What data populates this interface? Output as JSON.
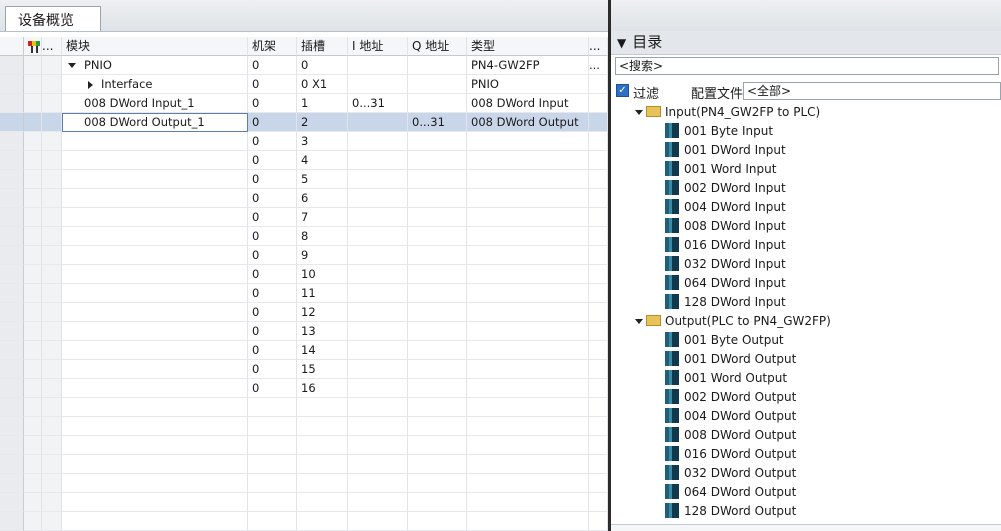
{
  "overview": {
    "tab_label": "设备概览",
    "columns": {
      "col_flags": "...",
      "module": "模块",
      "rack": "机架",
      "slot": "插槽",
      "i_addr": "I 地址",
      "q_addr": "Q 地址",
      "type": "类型",
      "more": "..."
    },
    "rows": [
      {
        "module": "PNIO",
        "rack": "0",
        "slot": "0",
        "i_addr": "",
        "q_addr": "",
        "type": "PN4-GW2FP",
        "extra": "...",
        "expander": "expanded",
        "level": 0
      },
      {
        "module": "Interface",
        "rack": "0",
        "slot": "0 X1",
        "i_addr": "",
        "q_addr": "",
        "type": "PNIO",
        "extra": "",
        "expander": "collapsed",
        "level": 1
      },
      {
        "module": "008 DWord Input_1",
        "rack": "0",
        "slot": "1",
        "i_addr": "0...31",
        "q_addr": "",
        "type": "008 DWord Input",
        "extra": "",
        "expander": "none",
        "level": 0
      },
      {
        "module": "008 DWord Output_1",
        "rack": "0",
        "slot": "2",
        "i_addr": "",
        "q_addr": "0...31",
        "type": "008 DWord Output",
        "extra": "",
        "expander": "none",
        "level": 0,
        "selected": true
      },
      {
        "module": "",
        "rack": "0",
        "slot": "3",
        "i_addr": "",
        "q_addr": "",
        "type": "",
        "extra": ""
      },
      {
        "module": "",
        "rack": "0",
        "slot": "4",
        "i_addr": "",
        "q_addr": "",
        "type": "",
        "extra": ""
      },
      {
        "module": "",
        "rack": "0",
        "slot": "5",
        "i_addr": "",
        "q_addr": "",
        "type": "",
        "extra": ""
      },
      {
        "module": "",
        "rack": "0",
        "slot": "6",
        "i_addr": "",
        "q_addr": "",
        "type": "",
        "extra": ""
      },
      {
        "module": "",
        "rack": "0",
        "slot": "7",
        "i_addr": "",
        "q_addr": "",
        "type": "",
        "extra": ""
      },
      {
        "module": "",
        "rack": "0",
        "slot": "8",
        "i_addr": "",
        "q_addr": "",
        "type": "",
        "extra": ""
      },
      {
        "module": "",
        "rack": "0",
        "slot": "9",
        "i_addr": "",
        "q_addr": "",
        "type": "",
        "extra": ""
      },
      {
        "module": "",
        "rack": "0",
        "slot": "10",
        "i_addr": "",
        "q_addr": "",
        "type": "",
        "extra": ""
      },
      {
        "module": "",
        "rack": "0",
        "slot": "11",
        "i_addr": "",
        "q_addr": "",
        "type": "",
        "extra": ""
      },
      {
        "module": "",
        "rack": "0",
        "slot": "12",
        "i_addr": "",
        "q_addr": "",
        "type": "",
        "extra": ""
      },
      {
        "module": "",
        "rack": "0",
        "slot": "13",
        "i_addr": "",
        "q_addr": "",
        "type": "",
        "extra": ""
      },
      {
        "module": "",
        "rack": "0",
        "slot": "14",
        "i_addr": "",
        "q_addr": "",
        "type": "",
        "extra": ""
      },
      {
        "module": "",
        "rack": "0",
        "slot": "15",
        "i_addr": "",
        "q_addr": "",
        "type": "",
        "extra": ""
      },
      {
        "module": "",
        "rack": "0",
        "slot": "16",
        "i_addr": "",
        "q_addr": "",
        "type": "",
        "extra": ""
      }
    ],
    "empty_row_count": 7
  },
  "catalog": {
    "title": "目录",
    "search_placeholder": "<搜索>",
    "filter_label": "过滤",
    "filter_checked": true,
    "config_label": "配置文件",
    "config_value": "<全部>",
    "folders": [
      {
        "label": "Input(PN4_GW2FP to PLC)",
        "items": [
          "001 Byte Input",
          "001 DWord Input",
          "001 Word Input",
          "002 DWord Input",
          "004 DWord Input",
          "008 DWord Input",
          "016 DWord Input",
          "032 DWord Input",
          "064 DWord Input",
          "128 DWord Input"
        ]
      },
      {
        "label": "Output(PLC to PN4_GW2FP)",
        "items": [
          "001 Byte Output",
          "001 DWord Output",
          "001 Word Output",
          "002 DWord Output",
          "004 DWord Output",
          "008 DWord Output",
          "016 DWord Output",
          "032 DWord Output",
          "064 DWord Output",
          "128 DWord Output"
        ]
      }
    ]
  },
  "icons": {
    "flags": "flags-icon",
    "folder": "folder-icon",
    "module": "module-icon"
  },
  "colors": {
    "selection": "#c9d6ea",
    "folder": "#e8c25a",
    "checkbox": "#2f6fc6"
  }
}
